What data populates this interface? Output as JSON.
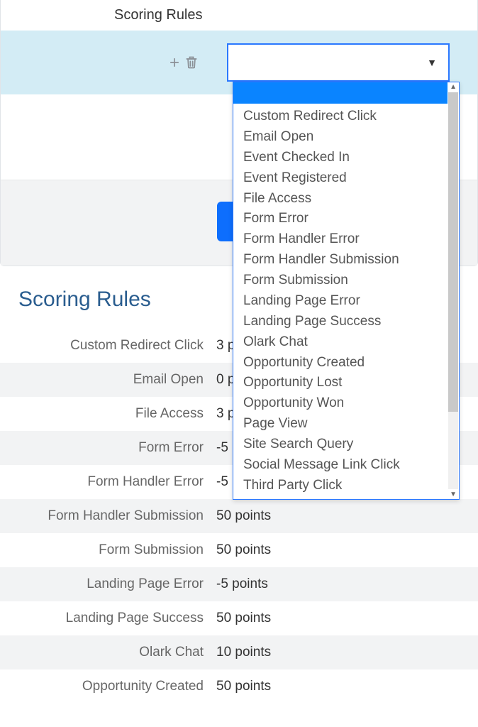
{
  "panel": {
    "title": "Scoring Rules"
  },
  "dropdown": {
    "options": [
      "Custom Redirect Click",
      "Email Open",
      "Event Checked In",
      "Event Registered",
      "File Access",
      "Form Error",
      "Form Handler Error",
      "Form Handler Submission",
      "Form Submission",
      "Landing Page Error",
      "Landing Page Success",
      "Olark Chat",
      "Opportunity Created",
      "Opportunity Lost",
      "Opportunity Won",
      "Page View",
      "Site Search Query",
      "Social Message Link Click",
      "Third Party Click"
    ]
  },
  "summary": {
    "heading": "Scoring Rules",
    "rows": [
      {
        "label": "Custom Redirect Click",
        "value": "3 points"
      },
      {
        "label": "Email Open",
        "value": "0 points"
      },
      {
        "label": "File Access",
        "value": "3 points"
      },
      {
        "label": "Form Error",
        "value": "-5 points"
      },
      {
        "label": "Form Handler Error",
        "value": "-5 points"
      },
      {
        "label": "Form Handler Submission",
        "value": "50 points"
      },
      {
        "label": "Form Submission",
        "value": "50 points"
      },
      {
        "label": "Landing Page Error",
        "value": "-5 points"
      },
      {
        "label": "Landing Page Success",
        "value": "50 points"
      },
      {
        "label": "Olark Chat",
        "value": "10 points"
      },
      {
        "label": "Opportunity Created",
        "value": "50 points"
      }
    ]
  }
}
